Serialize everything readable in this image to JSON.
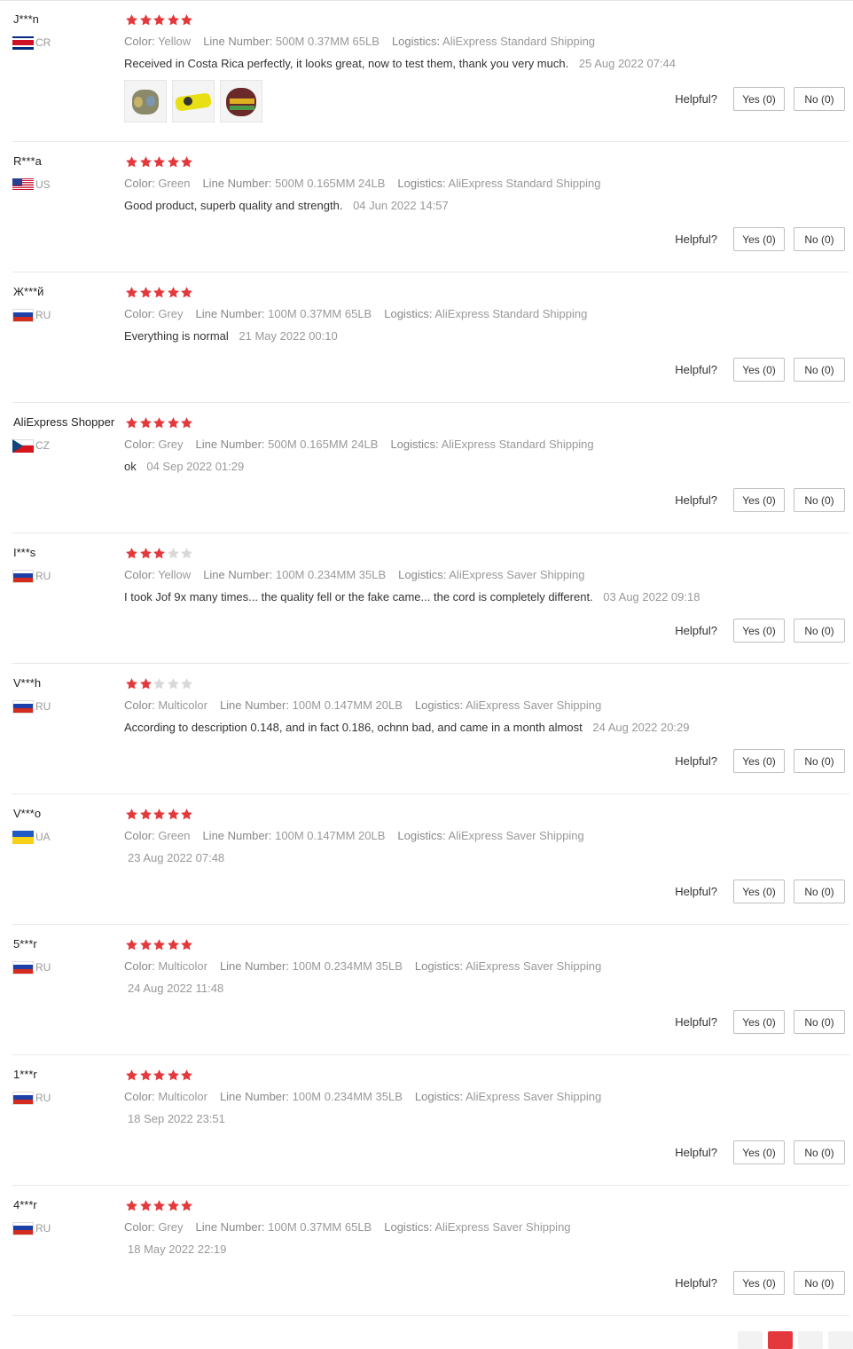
{
  "labels": {
    "color": "Color:",
    "line_number": "Line Number:",
    "logistics": "Logistics:",
    "helpful": "Helpful?",
    "yes": "Yes (0)",
    "no": "No (0)"
  },
  "colors": {
    "star_filled": "#e4393c",
    "star_empty": "#d9d9d9",
    "accent": "#e4393c"
  },
  "reviews": [
    {
      "user": "J***n",
      "country": "CR",
      "rating": 5,
      "color": "Yellow",
      "line_number": "500M 0.37MM 65LB",
      "logistics": "AliExpress Standard Shipping",
      "text": "Received in Costa Rica perfectly, it looks great, now to test them, thank you very much.",
      "date": "25 Aug 2022 07:44",
      "photos": 3
    },
    {
      "user": "R***a",
      "country": "US",
      "rating": 5,
      "color": "Green",
      "line_number": "500M 0.165MM 24LB",
      "logistics": "AliExpress Standard Shipping",
      "text": "Good product, superb quality and strength.",
      "date": "04 Jun 2022 14:57",
      "photos": 0
    },
    {
      "user": "Ж***й",
      "country": "RU",
      "rating": 5,
      "color": "Grey",
      "line_number": "100M 0.37MM 65LB",
      "logistics": "AliExpress Standard Shipping",
      "text": "Everything is normal",
      "date": "21 May 2022 00:10",
      "photos": 0
    },
    {
      "user": "AliExpress Shopper",
      "country": "CZ",
      "rating": 5,
      "color": "Grey",
      "line_number": "500M 0.165MM 24LB",
      "logistics": "AliExpress Standard Shipping",
      "text": "ok",
      "date": "04 Sep 2022 01:29",
      "photos": 0
    },
    {
      "user": "I***s",
      "country": "RU",
      "rating": 3,
      "color": "Yellow",
      "line_number": "100M 0.234MM 35LB",
      "logistics": "AliExpress Saver Shipping",
      "text": "I took Jof 9x many times... the quality fell or the fake came... the cord is completely different.",
      "date": "03 Aug 2022 09:18",
      "photos": 0
    },
    {
      "user": "V***h",
      "country": "RU",
      "rating": 2,
      "color": "Multicolor",
      "line_number": "100M 0.147MM 20LB",
      "logistics": "AliExpress Saver Shipping",
      "text": "According to description 0.148, and in fact 0.186, ochnn bad, and came in a month almost",
      "date": "24 Aug 2022 20:29",
      "photos": 0
    },
    {
      "user": "V***o",
      "country": "UA",
      "rating": 5,
      "color": "Green",
      "line_number": "100M 0.147MM 20LB",
      "logistics": "AliExpress Saver Shipping",
      "text": "",
      "date": "23 Aug 2022 07:48",
      "photos": 0
    },
    {
      "user": "5***r",
      "country": "RU",
      "rating": 5,
      "color": "Multicolor",
      "line_number": "100M 0.234MM 35LB",
      "logistics": "AliExpress Saver Shipping",
      "text": "",
      "date": "24 Aug 2022 11:48",
      "photos": 0
    },
    {
      "user": "1***r",
      "country": "RU",
      "rating": 5,
      "color": "Multicolor",
      "line_number": "100M 0.234MM 35LB",
      "logistics": "AliExpress Saver Shipping",
      "text": "",
      "date": "18 Sep 2022 23:51",
      "photos": 0
    },
    {
      "user": "4***r",
      "country": "RU",
      "rating": 5,
      "color": "Grey",
      "line_number": "100M 0.37MM 65LB",
      "logistics": "AliExpress Saver Shipping",
      "text": "",
      "date": "18 May 2022 22:19",
      "photos": 0
    }
  ],
  "pagination": {
    "active_index": 1,
    "count": 4
  }
}
